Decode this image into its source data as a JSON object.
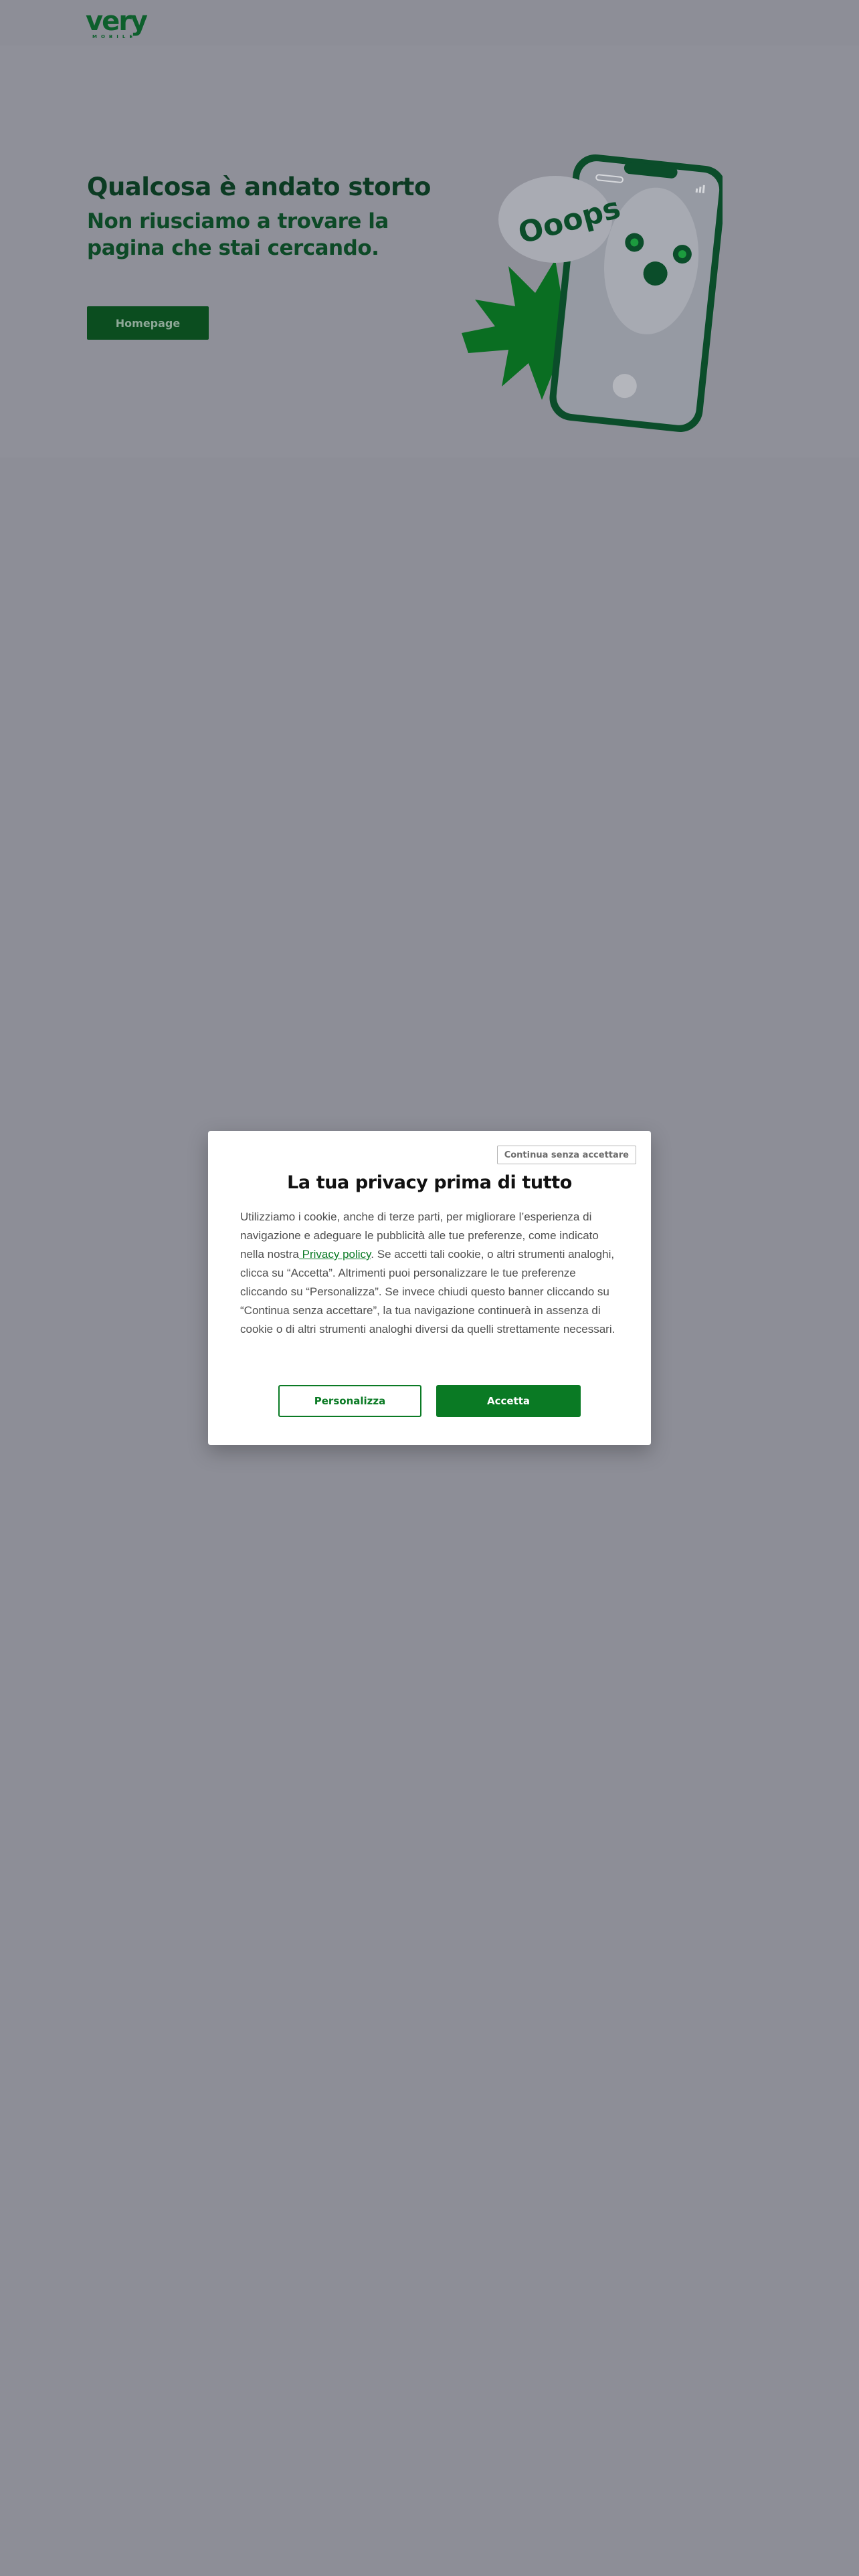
{
  "header": {
    "logo_text": "very",
    "logo_subtext": "MOBILE"
  },
  "hero": {
    "title": "Qualcosa è andato storto",
    "subtitle": "Non riusciamo a trovare la pagina che stai cercando.",
    "button_label": "Homepage",
    "illustration_text": "Ooops"
  },
  "cookie_banner": {
    "skip_label": "Continua senza accettare",
    "title": "La tua privacy prima di tutto",
    "body_before_link": "Utilizziamo i cookie, anche di terze parti, per migliorare l’esperienza di navigazione e adeguare le pubblicità alle tue preferenze, come indicato nella nostra",
    "link_label": " Privacy policy",
    "body_after_link": ". Se accetti tali cookie, o altri strumenti analoghi, clicca su “Accetta”. Altrimenti puoi personalizzare le tue preferenze cliccando su “Personalizza”. Se invece chiudi questo banner cliccando su “Continua senza accettare”, la tua navigazione continuerà in assenza di cookie o di altri strumenti analoghi diversi da quelli strettamente necessari.",
    "customize_label": "Personalizza",
    "accept_label": "Accetta"
  },
  "colors": {
    "brand_green": "#0a7a24",
    "dark_green": "#0c3b23",
    "overlay_gray": "#8d8e97"
  }
}
